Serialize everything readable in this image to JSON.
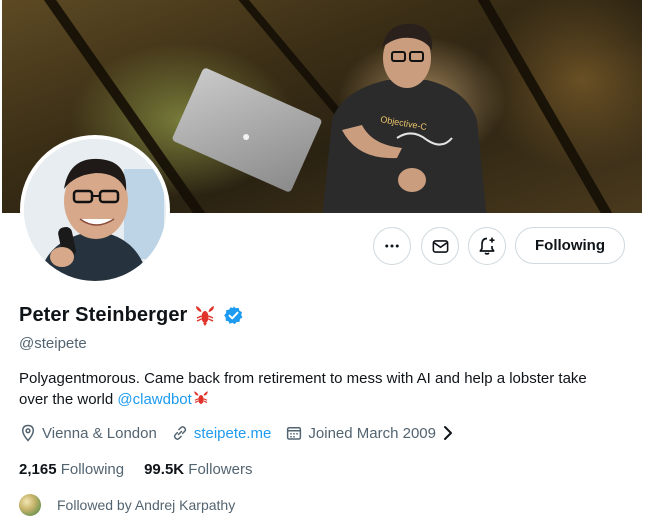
{
  "profile": {
    "name": "Peter Steinberger",
    "handle": "@steipete",
    "bio_text": "Polyagentmorous. Came back from retirement to mess with AI and help a lobster take over the world",
    "bio_mention": "@clawdbot",
    "location": "Vienna & London",
    "website": "steipete.me",
    "joined": "Joined March 2009",
    "following_count": "2,165",
    "following_label": "Following",
    "followers_count": "99.5K",
    "followers_label": "Followers",
    "followed_by": "Followed by Andrej Karpathy"
  },
  "banner": {
    "shirt_text": "Objective-C"
  },
  "actions": {
    "more_icon": "more-icon",
    "message_icon": "envelope-icon",
    "notify_icon": "bell-plus-icon",
    "following_label": "Following"
  },
  "colors": {
    "link": "#1d9bf0",
    "verified": "#1d9bf0",
    "lobster": "#e0312a",
    "secondary_text": "#536471"
  }
}
